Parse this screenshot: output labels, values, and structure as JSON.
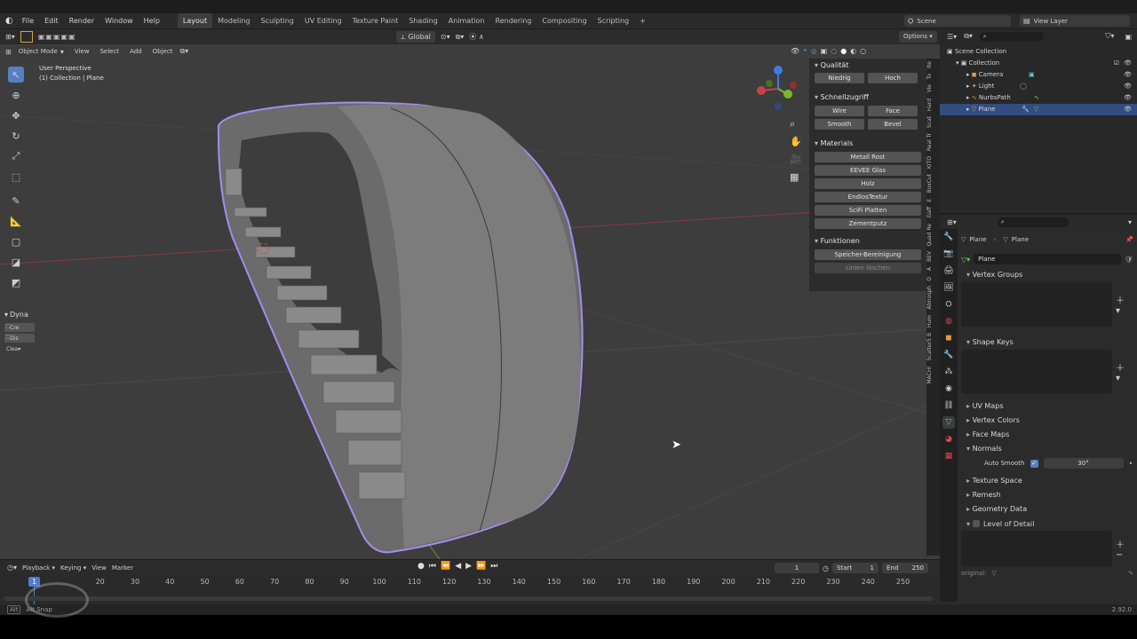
{
  "menu": {
    "items": [
      "File",
      "Edit",
      "Render",
      "Window",
      "Help"
    ]
  },
  "workspaces": {
    "tabs": [
      "Layout",
      "Modeling",
      "Sculpting",
      "UV Editing",
      "Texture Paint",
      "Shading",
      "Animation",
      "Rendering",
      "Compositing",
      "Scripting"
    ],
    "active": "Layout",
    "add": "+"
  },
  "scene": {
    "name": "Scene",
    "view_layer": "View Layer"
  },
  "toolbar2": {
    "transform": "Global",
    "options": "Options"
  },
  "viewport": {
    "mode": "Object Mode",
    "menus": [
      "View",
      "Select",
      "Add",
      "Object"
    ],
    "info_line1": "User Perspective",
    "info_line2": "(1) Collection | Plane",
    "left_panel_title": "Dyna",
    "left_panel_btns": [
      "Cre",
      "Dis",
      "Clea"
    ]
  },
  "npanel": {
    "sections": [
      {
        "title": "Qualität",
        "buttons": [
          [
            "Niedrig",
            "Hoch"
          ]
        ]
      },
      {
        "title": "Schnellzugriff",
        "buttons": [
          [
            "Wire",
            "Face"
          ],
          [
            "Smooth",
            "Bevel"
          ]
        ]
      },
      {
        "title": "Materials",
        "buttons": [
          [
            "Metall Rost"
          ],
          [
            "EEVEE Glas"
          ],
          [
            "Holz"
          ],
          [
            "EndlosTextur"
          ],
          [
            "SciFi Platten"
          ],
          [
            "Zementputz"
          ]
        ]
      },
      {
        "title": "Funktionen",
        "buttons": [
          [
            "Speicher-Bereinigung"
          ],
          [
            "Linien löschen"
          ]
        ]
      }
    ],
    "vtabs": [
      "Ite",
      "To",
      "Vie",
      "Hard",
      "Scat",
      "Real Tr",
      "KITO",
      "BoxCut",
      "E",
      "Gaff",
      "Quad Re",
      "BEV",
      "A",
      "O",
      "Atmosph",
      "Hum",
      "Scatter5 B",
      "MACHI"
    ]
  },
  "outliner": {
    "root": "Scene Collection",
    "collection": "Collection",
    "items": [
      "Camera",
      "Light",
      "NurbsPath",
      "Plane"
    ],
    "selected": "Plane"
  },
  "properties": {
    "breadcrumb_object": "Plane",
    "breadcrumb_data": "Plane",
    "mesh_name": "Plane",
    "sections_top": [
      "Vertex Groups",
      "Shape Keys"
    ],
    "sections_mid": [
      "UV Maps",
      "Vertex Colors",
      "Face Maps",
      "Normals"
    ],
    "auto_smooth_label": "Auto Smooth",
    "auto_smooth_angle": "30°",
    "sections_bottom": [
      "Texture Space",
      "Remesh",
      "Geometry Data",
      "Level of Detail"
    ],
    "original_label": "original:"
  },
  "timeline": {
    "menus": [
      "Playback",
      "Keying",
      "View",
      "Marker"
    ],
    "current_frame": "1",
    "start_label": "Start",
    "start": "1",
    "end_label": "End",
    "end": "250",
    "ticks": [
      "20",
      "30",
      "40",
      "50",
      "60",
      "70",
      "80",
      "90",
      "100",
      "110",
      "120",
      "130",
      "140",
      "150",
      "160",
      "170",
      "180",
      "190",
      "200",
      "210",
      "220",
      "230",
      "240",
      "250"
    ],
    "playhead": "1"
  },
  "status": {
    "left": "Alt",
    "hint": "Alt Snap",
    "version": "2.92.0"
  },
  "colors": {
    "selection_outline": "#a48cf0",
    "accent": "#5680c2",
    "x_axis": "#c8414a",
    "y_axis": "#7ab82b",
    "z_axis": "#3c7ee0"
  }
}
